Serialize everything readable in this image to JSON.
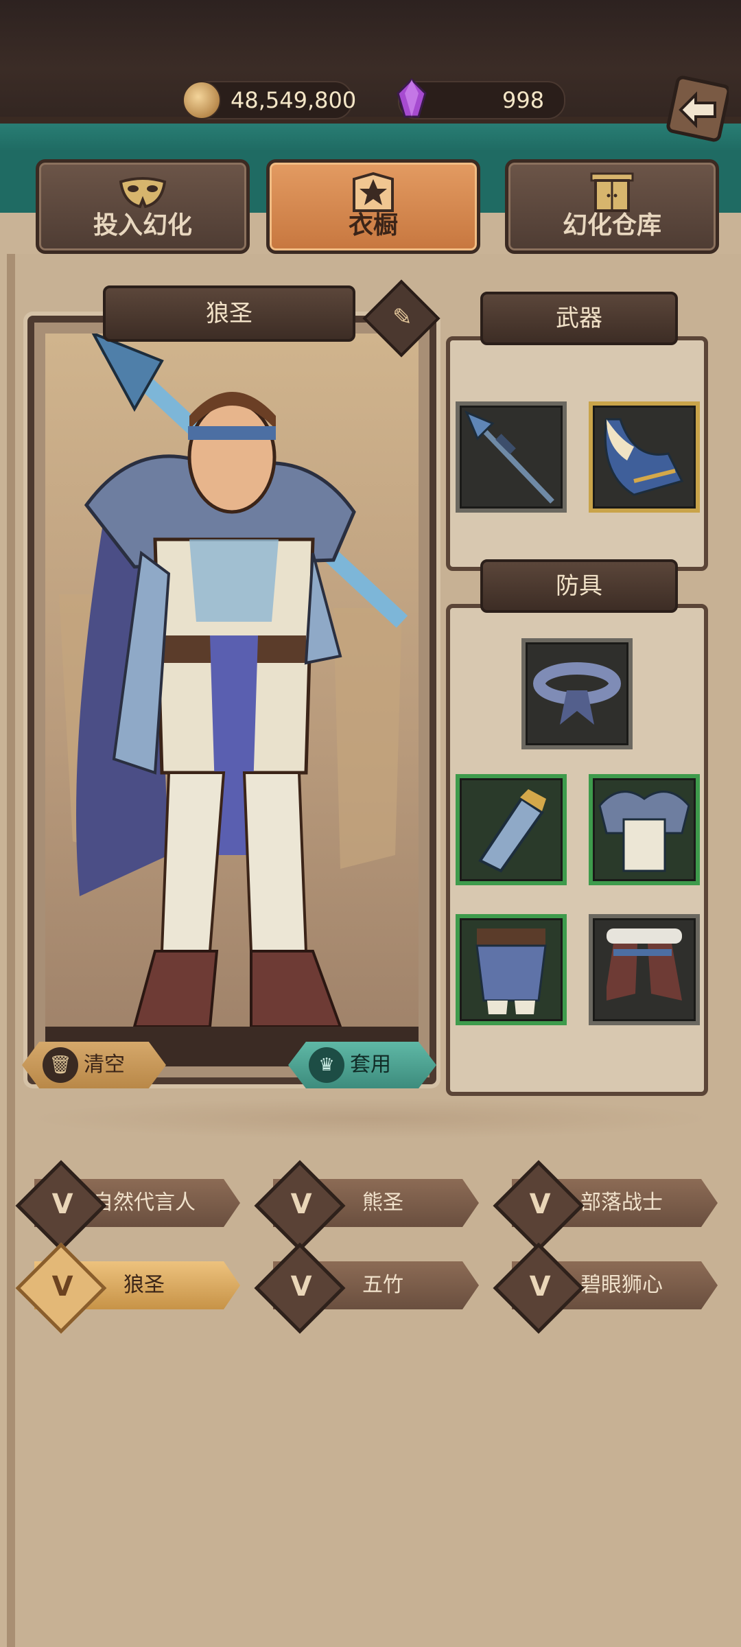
{
  "resources": {
    "gold": "48,549,800",
    "gems": "998"
  },
  "tabs": [
    {
      "label": "投入幻化",
      "icon": "mask-icon"
    },
    {
      "label": "衣橱",
      "icon": "wardrobe-icon"
    },
    {
      "label": "幻化仓库",
      "icon": "cabinet-icon"
    }
  ],
  "character": {
    "name": "狼圣"
  },
  "buttons": {
    "clear": "清空",
    "apply": "套用"
  },
  "sections": {
    "weapon": "武器",
    "armor": "防具"
  },
  "sets": [
    {
      "label": "自然代言人",
      "selected": false
    },
    {
      "label": "熊圣",
      "selected": false
    },
    {
      "label": "部落战士",
      "selected": false
    },
    {
      "label": "狼圣",
      "selected": true
    },
    {
      "label": "五竹",
      "selected": false
    },
    {
      "label": "碧眼狮心",
      "selected": false
    }
  ],
  "colors": {
    "active_tab": "#e39b62",
    "teal": "#1f6b63",
    "selected_set": "#edc27e"
  }
}
